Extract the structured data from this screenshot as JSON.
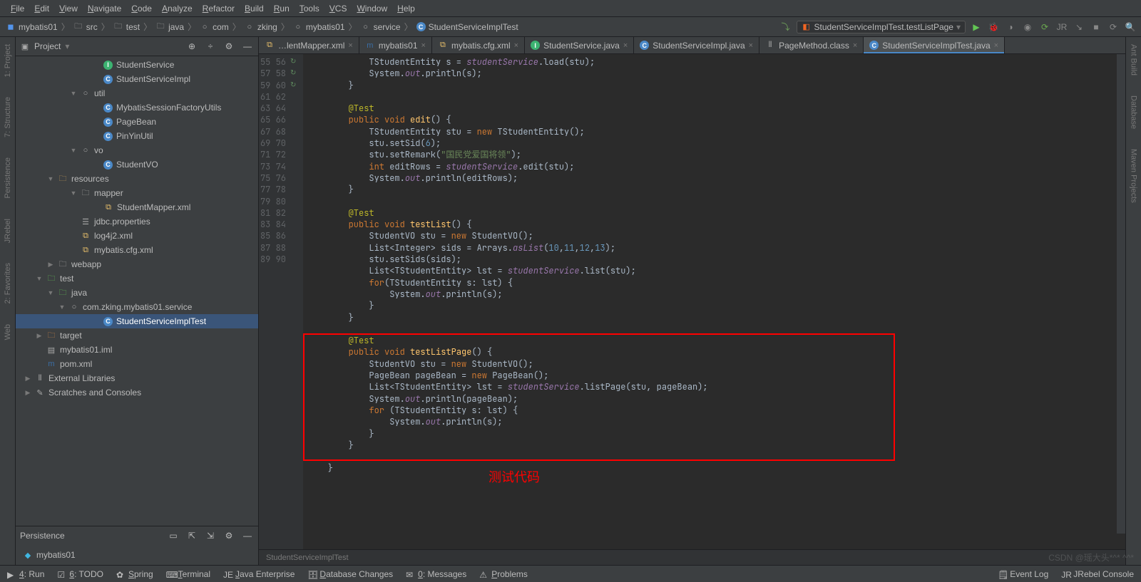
{
  "menu": [
    "File",
    "Edit",
    "View",
    "Navigate",
    "Code",
    "Analyze",
    "Refactor",
    "Build",
    "Run",
    "Tools",
    "VCS",
    "Window",
    "Help"
  ],
  "breadcrumbs": [
    {
      "icon": "mod",
      "label": "mybatis01"
    },
    {
      "icon": "dir",
      "label": "src"
    },
    {
      "icon": "dir",
      "label": "test"
    },
    {
      "icon": "dir",
      "label": "java"
    },
    {
      "icon": "pkg",
      "label": "com"
    },
    {
      "icon": "pkg",
      "label": "zking"
    },
    {
      "icon": "pkg",
      "label": "mybatis01"
    },
    {
      "icon": "pkg",
      "label": "service"
    },
    {
      "icon": "cls",
      "label": "StudentServiceImplTest"
    }
  ],
  "runconfig": "StudentServiceImplTest.testListPage",
  "left_tools": [
    "1: Project",
    "7: Structure",
    "Persistence",
    "JRebel",
    "2: Favorites",
    "Web"
  ],
  "right_tools": [
    "Ant Build",
    "Database",
    "Maven Projects"
  ],
  "project_view": {
    "title": "Project",
    "tree": [
      {
        "d": 6,
        "i": "int",
        "a": "",
        "l": "StudentService"
      },
      {
        "d": 6,
        "i": "cls",
        "a": "",
        "l": "StudentServiceImpl"
      },
      {
        "d": 4,
        "i": "pkg",
        "a": "▼",
        "l": "util"
      },
      {
        "d": 6,
        "i": "cls",
        "a": "",
        "l": "MybatisSessionFactoryUtils"
      },
      {
        "d": 6,
        "i": "cls",
        "a": "",
        "l": "PageBean"
      },
      {
        "d": 6,
        "i": "cls",
        "a": "",
        "l": "PinYinUtil"
      },
      {
        "d": 4,
        "i": "pkg",
        "a": "▼",
        "l": "vo"
      },
      {
        "d": 6,
        "i": "cls",
        "a": "",
        "l": "StudentVO"
      },
      {
        "d": 2,
        "i": "res",
        "a": "▼",
        "l": "resources"
      },
      {
        "d": 4,
        "i": "dir",
        "a": "▼",
        "l": "mapper"
      },
      {
        "d": 6,
        "i": "xml",
        "a": "",
        "l": "StudentMapper.xml"
      },
      {
        "d": 4,
        "i": "prop",
        "a": "",
        "l": "jdbc.properties"
      },
      {
        "d": 4,
        "i": "xml",
        "a": "",
        "l": "log4j2.xml"
      },
      {
        "d": 4,
        "i": "xml",
        "a": "",
        "l": "mybatis.cfg.xml"
      },
      {
        "d": 2,
        "i": "dir",
        "a": "▶",
        "l": "webapp"
      },
      {
        "d": 1,
        "i": "dir-g",
        "a": "▼",
        "l": "test"
      },
      {
        "d": 2,
        "i": "dir-g",
        "a": "▼",
        "l": "java"
      },
      {
        "d": 3,
        "i": "pkg",
        "a": "▼",
        "l": "com.zking.mybatis01.service"
      },
      {
        "d": 6,
        "i": "cls",
        "a": "",
        "l": "StudentServiceImplTest",
        "sel": true
      },
      {
        "d": 1,
        "i": "dir-o",
        "a": "▶",
        "l": "target"
      },
      {
        "d": 1,
        "i": "file",
        "a": "",
        "l": "mybatis01.iml"
      },
      {
        "d": 1,
        "i": "m",
        "a": "",
        "l": "pom.xml"
      },
      {
        "d": 0,
        "i": "lib",
        "a": "▶",
        "l": "External Libraries"
      },
      {
        "d": 0,
        "i": "scr",
        "a": "▶",
        "l": "Scratches and Consoles"
      }
    ]
  },
  "persistence": {
    "title": "Persistence",
    "item": "mybatis01"
  },
  "tabs": [
    {
      "icon": "xml",
      "label": "…lentMapper.xml",
      "active": false,
      "trunc": true
    },
    {
      "icon": "m",
      "label": "mybatis01",
      "active": false
    },
    {
      "icon": "xml",
      "label": "mybatis.cfg.xml",
      "active": false
    },
    {
      "icon": "int",
      "label": "StudentService.java",
      "active": false
    },
    {
      "icon": "cls",
      "label": "StudentServiceImpl.java",
      "active": false
    },
    {
      "icon": "lib",
      "label": "PageMethod.class",
      "active": false
    },
    {
      "icon": "cls",
      "label": "StudentServiceImplTest.java",
      "active": true
    }
  ],
  "line_start": 55,
  "line_end": 90,
  "gutter_marks": {
    "60": "↻",
    "69": "↻",
    "80": "↻"
  },
  "code_lines": [
    "            TStudentEntity s = <span class='fi'>studentService</span>.load(stu);",
    "            System.<span class='fi'>out</span>.println(s);",
    "        }",
    "",
    "        <span class='an'>@Test</span>",
    "        <span class='kw'>public void</span> <span class='me'>edit</span>() {",
    "            TStudentEntity stu = <span class='kw'>new</span> TStudentEntity();",
    "            stu.setSid(<span class='nu'>6</span>);",
    "            stu.setRemark(<span class='st'>\"国民党爱国将领\"</span>);",
    "            <span class='kw'>int</span> editRows = <span class='fi'>studentService</span>.edit(stu);",
    "            System.<span class='fi'>out</span>.println(editRows);",
    "        }",
    "",
    "        <span class='an'>@Test</span>",
    "        <span class='kw'>public void</span> <span class='me'>testList</span>() {",
    "            StudentVO stu = <span class='kw'>new</span> StudentVO();",
    "            List&lt;Integer&gt; sids = Arrays.<span class='fi'>asList</span>(<span class='nu'>10</span>,<span class='nu'>11</span>,<span class='nu'>12</span>,<span class='nu'>13</span>);",
    "            stu.setSids(sids);",
    "            List&lt;TStudentEntity&gt; lst = <span class='fi'>studentService</span>.list(stu);",
    "            <span class='kw'>for</span>(TStudentEntity s: lst) {",
    "                System.<span class='fi'>out</span>.println(s);",
    "            }",
    "        }",
    "",
    "        <span class='an'>@Test</span>",
    "        <span class='kw'>public void</span> <span class='me'>testListPage</span>() {",
    "            StudentVO stu = <span class='kw'>new</span> StudentVO();",
    "            PageBean pageBean = <span class='kw'>new</span> PageBean();",
    "            List&lt;TStudentEntity&gt; lst = <span class='fi'>studentService</span>.listPage(stu, pageBean);",
    "            System.<span class='fi'>out</span>.println(pageBean);",
    "            <span class='kw'>for</span> (TStudentEntity s: lst) {",
    "                System.<span class='fi'>out</span>.println(s);",
    "            }",
    "        }",
    "    ",
    "    }"
  ],
  "breadcrumb_bottom": "StudentServiceImplTest",
  "annotation_label": "测试代码",
  "status_left": [
    {
      "icon": "run",
      "label": "4: Run"
    },
    {
      "icon": "todo",
      "label": "6: TODO"
    },
    {
      "icon": "spring",
      "label": "Spring"
    },
    {
      "icon": "term",
      "label": "Terminal"
    },
    {
      "icon": "jee",
      "label": "Java Enterprise"
    },
    {
      "icon": "db",
      "label": "Database Changes"
    },
    {
      "icon": "msg",
      "label": "0: Messages"
    },
    {
      "icon": "prob",
      "label": "Problems"
    }
  ],
  "status_right": [
    {
      "icon": "log",
      "label": "Event Log"
    },
    {
      "icon": "jr",
      "label": "JRebel Console"
    }
  ],
  "watermark": "CSDN @瑶大头*^*  ^^*"
}
